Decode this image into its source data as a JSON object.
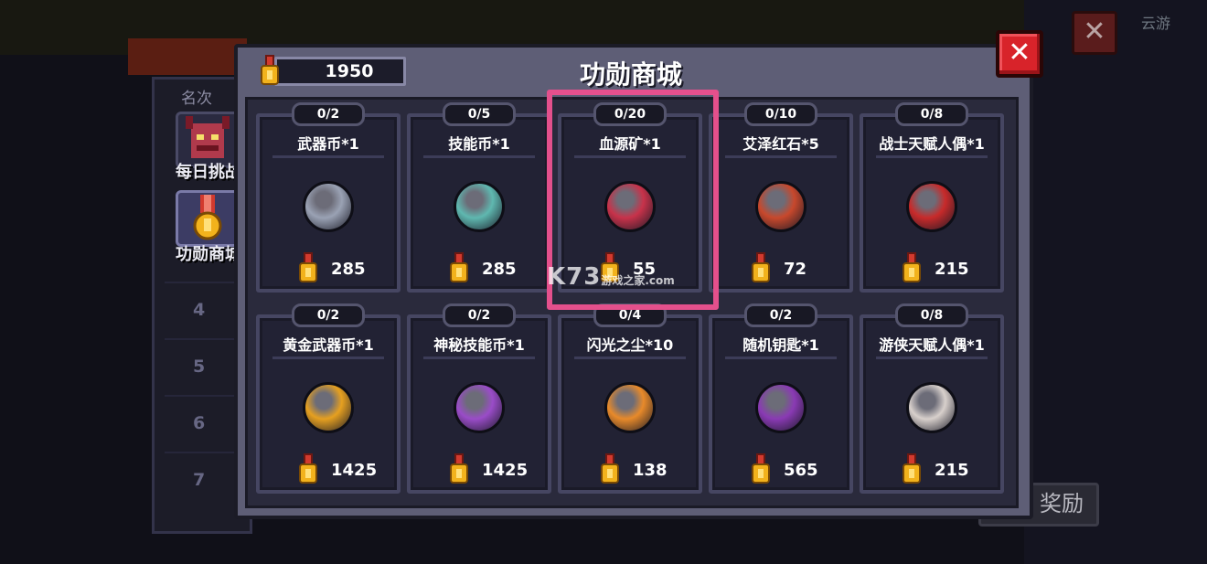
{
  "header": {
    "title": "功勋商城",
    "currency_value": "1950",
    "close_label": "✕"
  },
  "sidebar": {
    "column_header": "名次",
    "items": [
      {
        "label": "每日挑战",
        "icon": "demon-helmet-icon"
      },
      {
        "label": "功勋商城",
        "icon": "medal-icon"
      }
    ],
    "ranks": [
      "4",
      "5",
      "6",
      "7"
    ]
  },
  "background": {
    "reward_button": "奖励",
    "corner_text": "云游"
  },
  "shop": {
    "items": [
      {
        "limit": "0/2",
        "name": "武器币*1",
        "price": "285",
        "icon": "weapon-coin-icon",
        "color": "#9aa2b4"
      },
      {
        "limit": "0/5",
        "name": "技能币*1",
        "price": "285",
        "icon": "skill-coin-icon",
        "color": "#5fb8b0"
      },
      {
        "limit": "0/20",
        "name": "血源矿*1",
        "price": "55",
        "icon": "blood-ore-icon",
        "color": "#c8324a"
      },
      {
        "limit": "0/10",
        "name": "艾泽红石*5",
        "price": "72",
        "icon": "red-stone-icon",
        "color": "#c8482c"
      },
      {
        "limit": "0/8",
        "name": "战士天赋人偶*1",
        "price": "215",
        "icon": "warrior-doll-icon",
        "color": "#c82a2a"
      },
      {
        "limit": "0/2",
        "name": "黄金武器币*1",
        "price": "1425",
        "icon": "golden-weapon-coin-icon",
        "color": "#e6a020"
      },
      {
        "limit": "0/2",
        "name": "神秘技能币*1",
        "price": "1425",
        "icon": "mystic-skill-coin-icon",
        "color": "#9a4cc8"
      },
      {
        "limit": "0/4",
        "name": "闪光之尘*10",
        "price": "138",
        "icon": "sparkle-dust-icon",
        "color": "#e88a2a"
      },
      {
        "limit": "0/2",
        "name": "随机钥匙*1",
        "price": "565",
        "icon": "random-key-icon",
        "color": "#8a3ab4"
      },
      {
        "limit": "0/8",
        "name": "游侠天赋人偶*1",
        "price": "215",
        "icon": "ranger-doll-icon",
        "color": "#d8d0cc"
      }
    ]
  },
  "watermark": {
    "main": "K73",
    "sub": "游戏之家",
    "domain": ".com"
  },
  "colors": {
    "accent": "#e4508c",
    "close": "#d8232a",
    "medal": "#f2b21c"
  }
}
